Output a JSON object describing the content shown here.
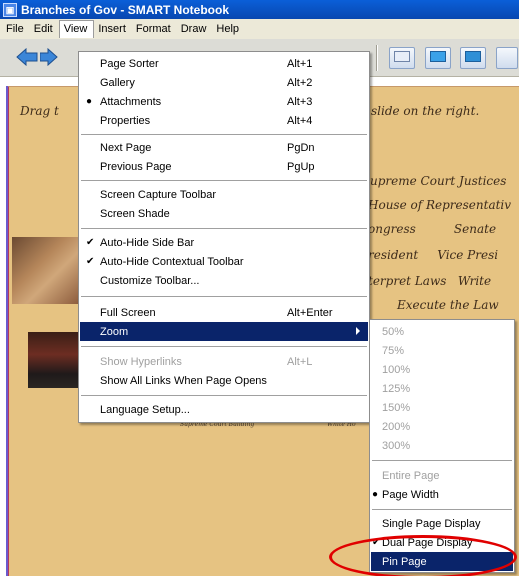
{
  "window": {
    "title": "Branches of Gov - SMART Notebook"
  },
  "menubar": [
    "File",
    "Edit",
    "View",
    "Insert",
    "Format",
    "Draw",
    "Help"
  ],
  "page_text": {
    "instruction_left": "Drag t",
    "instruction_right": "slide on the right.",
    "lines": [
      "upreme Court Justices",
      "House of Representativ",
      "ongress          Senate",
      "resident     Vice Presi",
      "terpret Laws   Write",
      "Execute the Law"
    ],
    "caption_left": "Supreme Court Building",
    "caption_right": "White Ho"
  },
  "view_menu": {
    "items": [
      {
        "label": "Page Sorter",
        "shortcut": "Alt+1",
        "mark": ""
      },
      {
        "label": "Gallery",
        "shortcut": "Alt+2",
        "mark": ""
      },
      {
        "label": "Attachments",
        "shortcut": "Alt+3",
        "mark": "●"
      },
      {
        "label": "Properties",
        "shortcut": "Alt+4",
        "mark": ""
      },
      {
        "label": "Next Page",
        "shortcut": "PgDn",
        "mark": ""
      },
      {
        "label": "Previous Page",
        "shortcut": "PgUp",
        "mark": ""
      },
      {
        "label": "Screen Capture Toolbar",
        "shortcut": "",
        "mark": ""
      },
      {
        "label": "Screen Shade",
        "shortcut": "",
        "mark": ""
      },
      {
        "label": "Auto-Hide Side Bar",
        "shortcut": "",
        "mark": "✔"
      },
      {
        "label": "Auto-Hide Contextual Toolbar",
        "shortcut": "",
        "mark": "✔"
      },
      {
        "label": "Customize Toolbar...",
        "shortcut": "",
        "mark": ""
      },
      {
        "label": "Full Screen",
        "shortcut": "Alt+Enter",
        "mark": ""
      },
      {
        "label": "Zoom",
        "shortcut": "",
        "mark": ""
      },
      {
        "label": "Show Hyperlinks",
        "shortcut": "Alt+L",
        "mark": ""
      },
      {
        "label": "Show All Links When Page Opens",
        "shortcut": "",
        "mark": ""
      },
      {
        "label": "Language Setup...",
        "shortcut": "",
        "mark": ""
      }
    ]
  },
  "zoom_submenu": {
    "items": [
      {
        "label": "50%",
        "mark": ""
      },
      {
        "label": "75%",
        "mark": ""
      },
      {
        "label": "100%",
        "mark": ""
      },
      {
        "label": "125%",
        "mark": ""
      },
      {
        "label": "150%",
        "mark": ""
      },
      {
        "label": "200%",
        "mark": ""
      },
      {
        "label": "300%",
        "mark": ""
      },
      {
        "label": "Entire Page",
        "mark": ""
      },
      {
        "label": "Page Width",
        "mark": "●"
      },
      {
        "label": "Single Page Display",
        "mark": ""
      },
      {
        "label": "Dual Page Display",
        "mark": "✔"
      },
      {
        "label": "Pin Page",
        "mark": ""
      }
    ]
  },
  "colors": {
    "title_bar": "#0a5fd8",
    "menu_highlight": "#0a246a",
    "page_background": "#e6c382",
    "highlight_circle": "#e00000"
  }
}
